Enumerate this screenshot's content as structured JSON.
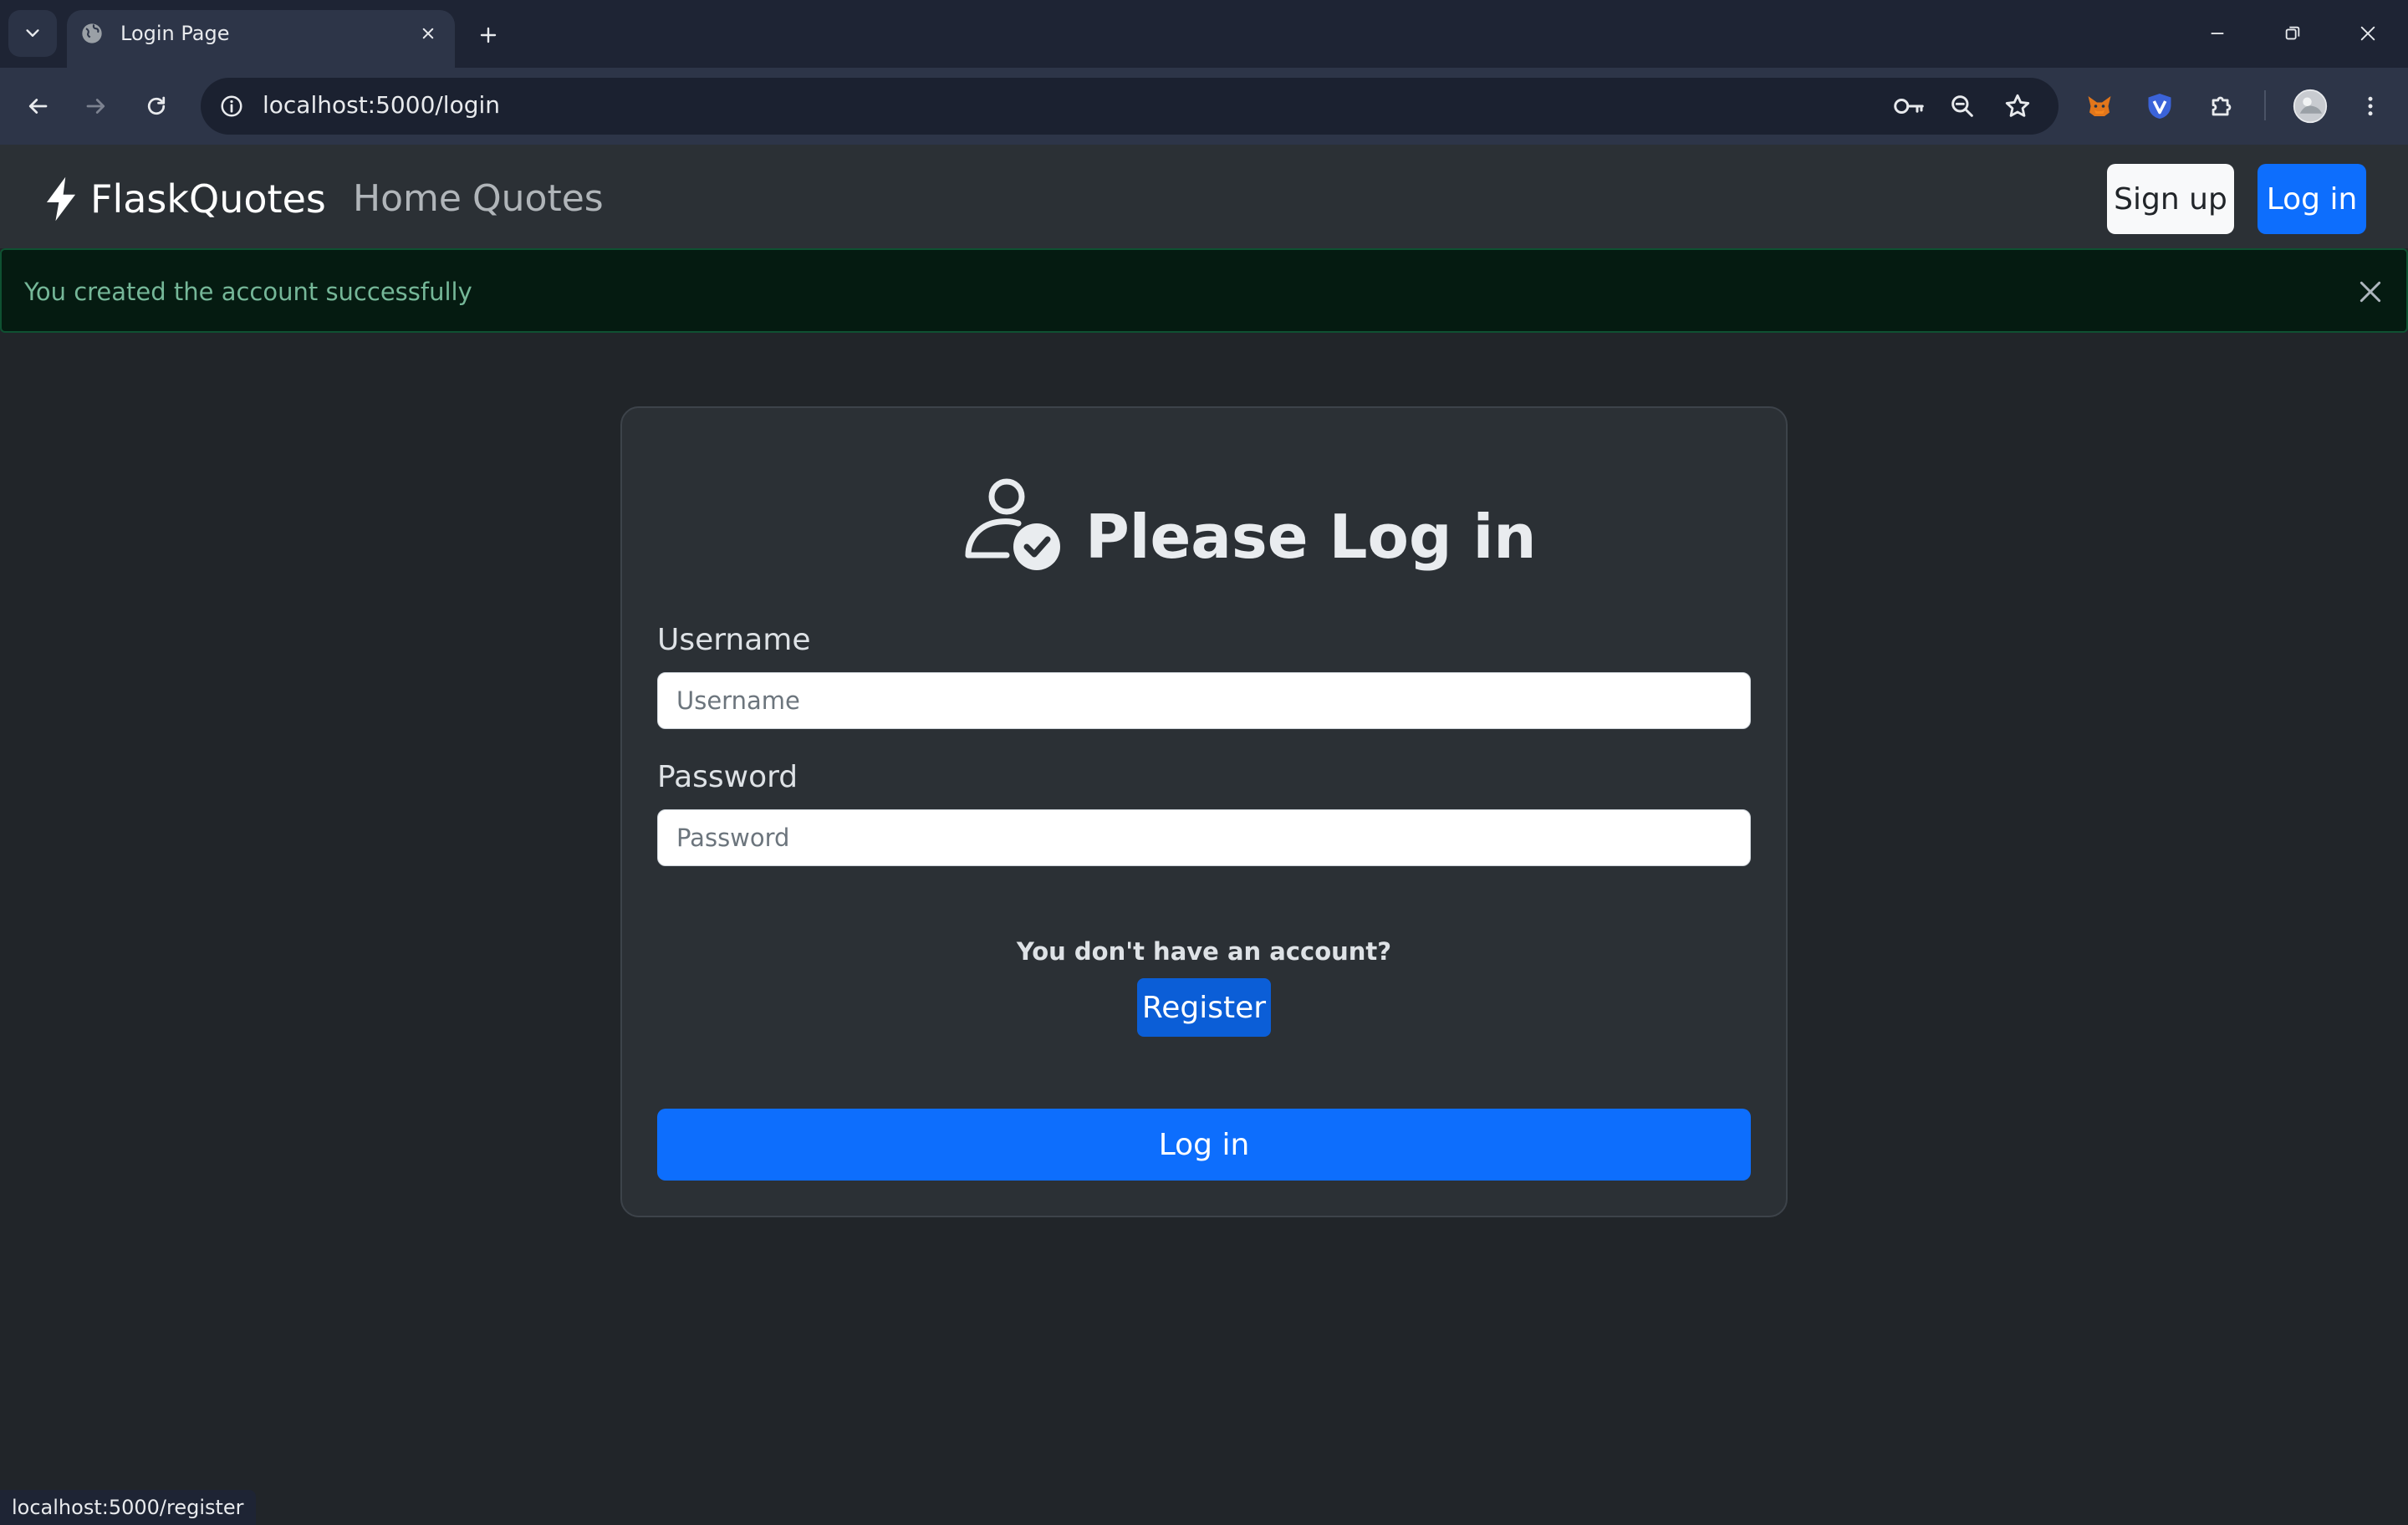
{
  "browser": {
    "tab": {
      "title": "Login Page"
    },
    "address_bar": {
      "url": "localhost:5000/login"
    },
    "status_url": "localhost:5000/register",
    "icons": {
      "tab_search": "chevron-down-icon",
      "favicon": "globe-icon",
      "tab_close": "close-icon",
      "new_tab": "plus-icon",
      "back": "arrow-left-icon",
      "forward": "arrow-right-icon",
      "reload": "reload-icon",
      "site_info": "info-icon",
      "password": "key-icon",
      "zoom": "zoom-out-icon",
      "bookmark": "star-icon",
      "extensions": [
        "metamask-fox-icon",
        "v-shield-icon",
        "puzzle-icon"
      ],
      "profile": "avatar",
      "menu": "kebab-menu-icon"
    }
  },
  "navbar": {
    "brand": "FlaskQuotes",
    "brand_icon": "lightning-icon",
    "links": [
      "Home",
      "Quotes"
    ],
    "signup_label": "Sign up",
    "login_label": "Log in"
  },
  "alert": {
    "message": "You created the account successfully",
    "type": "success"
  },
  "login_form": {
    "icon": "user-check-icon",
    "title": "Please Log in",
    "username": {
      "label": "Username",
      "placeholder": "Username",
      "value": ""
    },
    "password": {
      "label": "Password",
      "placeholder": "Password",
      "value": ""
    },
    "register_prompt": "You don't have an account?",
    "register_label": "Register",
    "submit_label": "Log in"
  },
  "colors": {
    "page_bg": "#212529",
    "navbar_bg": "#2b3035",
    "card_bg": "#2b3035",
    "primary": "#0d6efd",
    "alert_bg": "#051b11",
    "alert_text": "#75b798"
  }
}
